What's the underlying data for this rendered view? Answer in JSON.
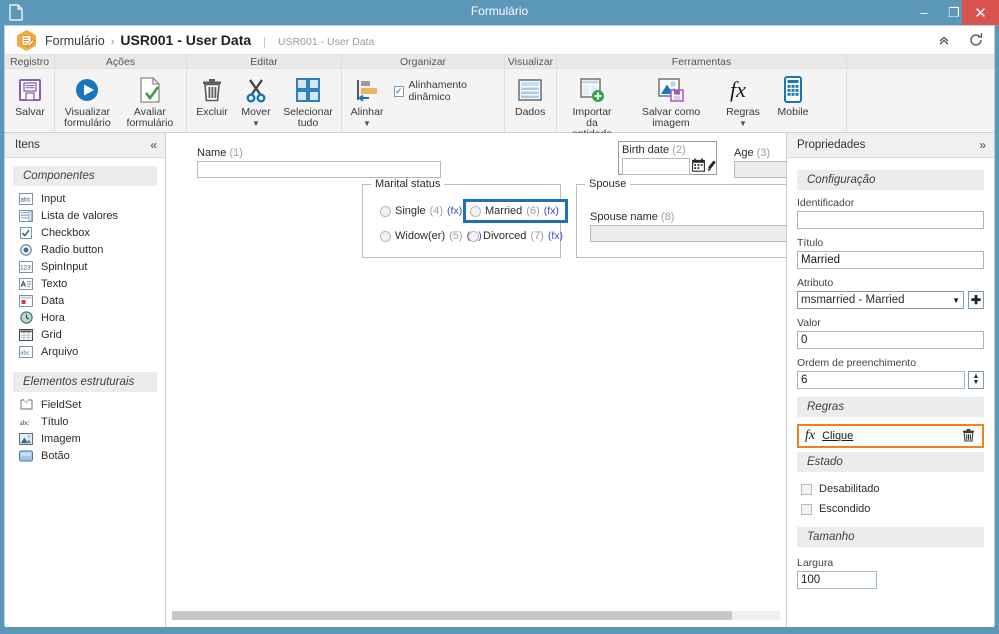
{
  "window": {
    "title": "Formulário",
    "doc_icon": "document-icon",
    "minimize_label": "–",
    "maximize_label": "❐",
    "close_label": "✕"
  },
  "breadcrumb": {
    "logo_icon": "form-app-logo-icon",
    "root": "Formulário",
    "separator": "›",
    "current": "USR001 - User Data",
    "pipe": "|",
    "subtitle": "USR001 - User Data",
    "collapse_icon": "chevron-up-double-icon",
    "refresh_icon": "refresh-icon"
  },
  "ribbon": {
    "groups": [
      {
        "label": "Registro",
        "buttons": [
          {
            "label": "Salvar",
            "icon": "save-floppy-icon",
            "caret": false
          }
        ]
      },
      {
        "label": "Ações",
        "buttons": [
          {
            "label": "Visualizar formulário",
            "icon": "preview-play-icon",
            "caret": false
          },
          {
            "label": "Avaliar formulário",
            "icon": "evaluate-check-document-icon",
            "caret": false
          }
        ]
      },
      {
        "label": "Editar",
        "buttons": [
          {
            "label": "Excluir",
            "icon": "trash-icon",
            "caret": false
          },
          {
            "label": "Mover",
            "icon": "scissors-icon",
            "caret": true
          },
          {
            "label": "Selecionar tudo",
            "icon": "select-all-grid-icon",
            "caret": false
          }
        ]
      },
      {
        "label": "Organizar",
        "buttons": [
          {
            "label": "Alinhar",
            "icon": "align-left-icon",
            "caret": true
          }
        ],
        "checkbox": {
          "label": "Alinhamento dinâmico",
          "checked": true,
          "mark": "✓"
        }
      },
      {
        "label": "Visualizar",
        "buttons": [
          {
            "label": "Dados",
            "icon": "data-table-icon",
            "caret": false
          }
        ]
      },
      {
        "label": "Ferramentas",
        "buttons": [
          {
            "label": "Importar da entidade",
            "icon": "import-entity-icon",
            "caret": false
          },
          {
            "label": "Salvar como imagem",
            "icon": "save-as-image-icon",
            "caret": false
          },
          {
            "label": "Regras",
            "icon": "fx-rules-icon",
            "caret": true
          },
          {
            "label": "Mobile",
            "icon": "mobile-device-icon",
            "caret": false
          }
        ]
      }
    ]
  },
  "left_panel": {
    "title": "Itens",
    "collapse_icon": "chevron-left-double-icon",
    "sections": [
      {
        "title": "Componentes",
        "items": [
          {
            "label": "Input",
            "icon": "abc-input-icon"
          },
          {
            "label": "Lista de valores",
            "icon": "value-list-icon"
          },
          {
            "label": "Checkbox",
            "icon": "checkbox-icon"
          },
          {
            "label": "Radio button",
            "icon": "radio-button-icon"
          },
          {
            "label": "SpinInput",
            "icon": "spin-input-123-icon"
          },
          {
            "label": "Texto",
            "icon": "text-icon"
          },
          {
            "label": "Data",
            "icon": "date-icon"
          },
          {
            "label": "Hora",
            "icon": "clock-icon"
          },
          {
            "label": "Grid",
            "icon": "grid-icon"
          },
          {
            "label": "Arquivo",
            "icon": "file-abc-icon"
          }
        ]
      },
      {
        "title": "Elementos estruturais",
        "items": [
          {
            "label": "FieldSet",
            "icon": "fieldset-icon"
          },
          {
            "label": "Título",
            "icon": "abc-title-icon"
          },
          {
            "label": "Imagem",
            "icon": "image-icon"
          },
          {
            "label": "Botão",
            "icon": "button-icon"
          }
        ]
      }
    ]
  },
  "canvas": {
    "fields": {
      "name": {
        "label": "Name",
        "order": "(1)",
        "value": ""
      },
      "birth_date": {
        "label": "Birth date",
        "order": "(2)",
        "value": "",
        "calendar_icon": "calendar-icon",
        "pick-icon": "date-picker-icon"
      },
      "age": {
        "label": "Age",
        "order": "(3)",
        "value": ""
      },
      "spouse_name": {
        "label": "Spouse name",
        "order": "(8)",
        "value": ""
      }
    },
    "fieldsets": {
      "marital": {
        "legend": "Marital status",
        "options": [
          {
            "label": "Single",
            "order": "(4)",
            "fx": "(fx)",
            "selected": false
          },
          {
            "label": "Married",
            "order": "(6)",
            "fx": "(fx)",
            "selected": true
          },
          {
            "label": "Widow(er)",
            "order": "(5)",
            "fx": "(fx)",
            "selected": false
          },
          {
            "label": "Divorced",
            "order": "(7)",
            "fx": "(fx)",
            "selected": false
          }
        ]
      },
      "spouse": {
        "legend": "Spouse"
      }
    },
    "scrollbar": {
      "name": "horizontal-scrollbar"
    }
  },
  "right_panel": {
    "title": "Propriedades",
    "expand_icon": "chevron-right-double-icon",
    "sections": {
      "configuracao": {
        "title": "Configuração",
        "identificador": {
          "label": "Identificador",
          "value": ""
        },
        "titulo": {
          "label": "Título",
          "value": "Married"
        },
        "atributo": {
          "label": "Atributo",
          "value": "msmarried - Married",
          "arrow": "▼",
          "add": "✚"
        },
        "valor": {
          "label": "Valor",
          "value": "0"
        },
        "ordem": {
          "label": "Ordem de preenchimento",
          "value": "6",
          "up": "▲",
          "down": "▼"
        }
      },
      "regras": {
        "title": "Regras",
        "rule": {
          "fx": "fx",
          "label": "Clique",
          "delete_icon": "trash-icon"
        }
      },
      "estado": {
        "title": "Estado",
        "items": [
          {
            "label": "Desabilitado",
            "checked": false
          },
          {
            "label": "Escondido",
            "checked": false
          }
        ]
      },
      "tamanho": {
        "title": "Tamanho",
        "largura": {
          "label": "Largura",
          "value": "100"
        }
      }
    }
  },
  "colors": {
    "window_frame": "#5b97b8",
    "close_button": "#d9534f",
    "accent_selection": "#1f6fbf",
    "rule_highlight": "#f08020",
    "fx_link": "#3b49cf",
    "logo_orange": "#f0a732"
  }
}
